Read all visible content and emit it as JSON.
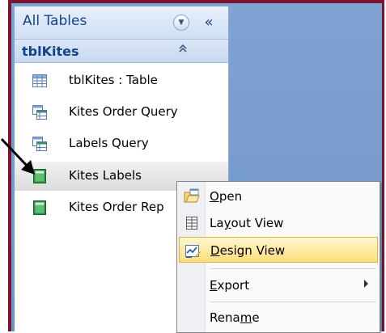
{
  "nav": {
    "header_title": "All Tables",
    "collapse_glyph": "«",
    "group_title": "tblKites",
    "group_toggle_glyph": "≈",
    "items": [
      {
        "label": "tblKites : Table",
        "icon": "table-icon"
      },
      {
        "label": "Kites Order Query",
        "icon": "query-icon"
      },
      {
        "label": "Labels Query",
        "icon": "query-icon"
      },
      {
        "label": "Kites Labels",
        "icon": "report-icon"
      },
      {
        "label": "Kites Order Rep",
        "icon": "report-icon"
      }
    ]
  },
  "context_menu": {
    "items": [
      {
        "mnemonic": "O",
        "rest": "pen",
        "icon": "open-icon"
      },
      {
        "prefix": "La",
        "mnemonic": "y",
        "rest": "out View",
        "icon": "layout-view-icon"
      },
      {
        "mnemonic": "D",
        "rest": "esign View",
        "icon": "design-view-icon"
      },
      {
        "mnemonic": "E",
        "rest": "xport",
        "icon": "export-submenu"
      },
      {
        "prefix": "Rena",
        "mnemonic": "m",
        "rest": "e",
        "icon": "rename"
      }
    ]
  },
  "colors": {
    "frame": "#7a1530",
    "app_background": "#6f95c8",
    "header_text": "#15428b",
    "menu_highlight": "#ffdd7a"
  }
}
